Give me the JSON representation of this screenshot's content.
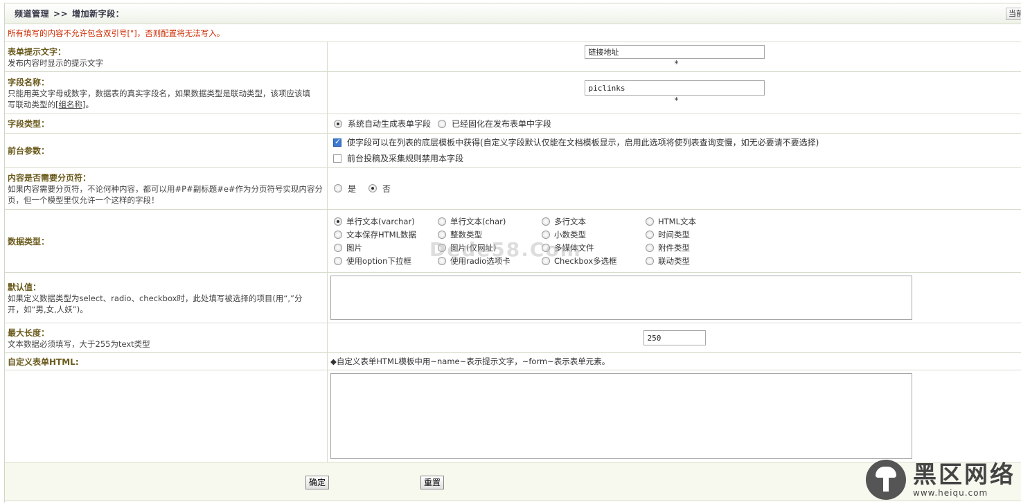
{
  "header": {
    "breadcrumb_root": "频道管理",
    "breadcrumb_sep": ">>",
    "breadcrumb_current": "增加新字段：",
    "top_button": "当前"
  },
  "warning": "所有填写的内容不允许包含双引号[\"]，否则配置将无法写入。",
  "fields": {
    "prompt": {
      "title": "表单提示文字：",
      "desc": "发布内容时显示的提示文字",
      "value": "链接地址",
      "required": "*"
    },
    "name": {
      "title": "字段名称：",
      "desc1": "只能用英文字母或数字，数据表的真实字段名，如果数据类型是联动类型，该项应该填",
      "desc2_pre": "写联动类型的",
      "desc2_link": "[组名称]",
      "desc2_post": "。",
      "value": "piclinks",
      "required": "*"
    },
    "field_type": {
      "title": "字段类型：",
      "opt1": "系统自动生成表单字段",
      "opt2": "已经固化在发布表单中字段"
    },
    "frontend": {
      "title": "前台参数：",
      "check1": "使字段可以在列表的底层模板中获得(自定义字段默认仅能在文档模板显示，启用此选项将使列表查询变慢，如无必要请不要选择)",
      "check2": "前台投稿及采集规则禁用本字段"
    },
    "paging": {
      "title": "内容是否需要分页符：",
      "desc1": "如果内容需要分页符，不论何种内容，都可以用#P#副标题#e#作为分页符号实现内容分",
      "desc2": "页，但一个模型里仅允许一个这样的字段！",
      "yes": "是",
      "no": "否"
    },
    "data_type": {
      "title": "数据类型：",
      "options": [
        "单行文本(varchar)",
        "单行文本(char)",
        "多行文本",
        "HTML文本",
        "文本保存HTML数据",
        "整数类型",
        "小数类型",
        "时间类型",
        "图片",
        "图片(仅网址)",
        "多媒体文件",
        "附件类型",
        "使用option下拉框",
        "使用radio选项卡",
        "Checkbox多选框",
        "联动类型"
      ]
    },
    "default": {
      "title": "默认值：",
      "desc1": "如果定义数据类型为select、radio、checkbox时，此处填写被选择的项目(用“,”分",
      "desc2": "开，如“男,女,人妖”)。"
    },
    "maxlen": {
      "title": "最大长度：",
      "desc": "文本数据必须填写，大于255为text类型",
      "value": "250"
    },
    "custom_html": {
      "title": "自定义表单HTML:",
      "hint": "◆自定义表单HTML模板中用~name~表示提示文字，~form~表示表单元素。"
    }
  },
  "footer": {
    "ok": "确定",
    "reset": "重置"
  },
  "watermark": "Dede58.Com",
  "logo": {
    "name": "黑区网络",
    "url": "www.heiqu.com"
  }
}
